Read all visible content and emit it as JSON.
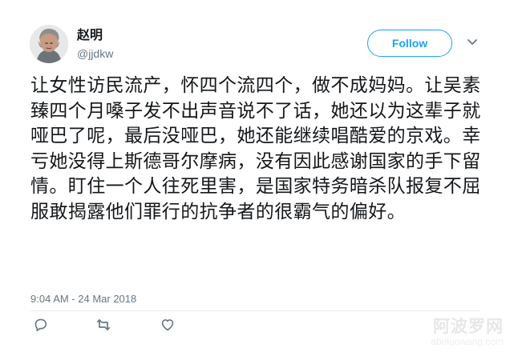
{
  "tweet": {
    "author": {
      "display_name": "赵明",
      "screen_name": "@jjdkw"
    },
    "follow_label": "Follow",
    "text": "让女性访民流产，怀四个流四个，做不成妈妈。让吴素臻四个月嗓子发不出声音说不了话，她还以为这辈子就哑巴了呢，最后没哑巴，她还能继续唱酷爱的京戏。幸亏她没得上斯德哥尔摩病，没有因此感谢国家的手下留情。盯住一个人往死里害，是国家特务暗杀队报复不屈服敢揭露他们罪行的抗争者的很霸气的偏好。",
    "timestamp": "9:04 AM - 24 Mar 2018",
    "icons": {
      "avatar": "avatar",
      "more": "chevron-down-icon",
      "reply": "reply-icon",
      "retweet": "retweet-icon",
      "like": "heart-icon"
    },
    "colors": {
      "accent": "#1da1f2",
      "text": "#14171a",
      "muted": "#657786"
    }
  },
  "watermark": {
    "site_name": "阿波罗网",
    "domain": "aboluowang.com"
  }
}
